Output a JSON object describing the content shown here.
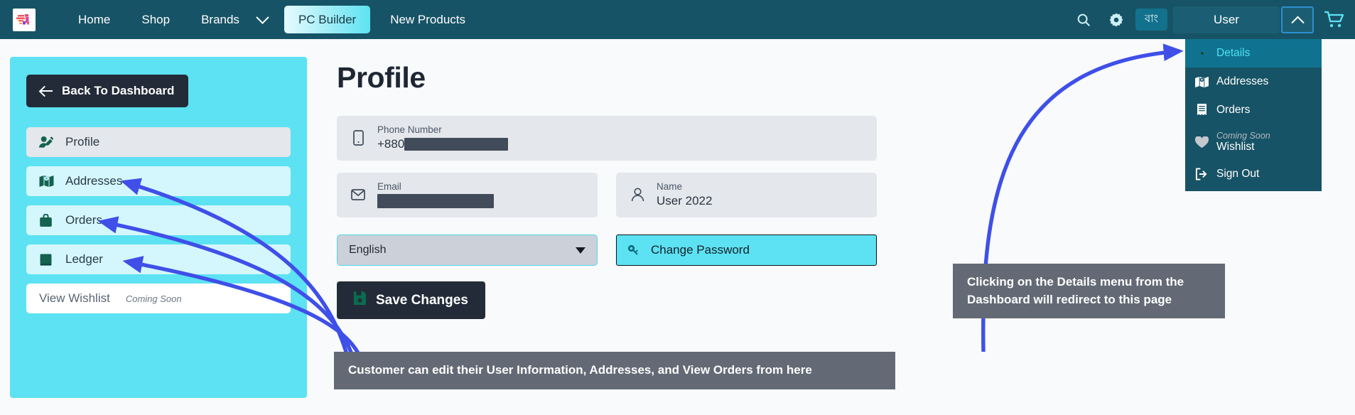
{
  "navbar": {
    "logo_name": "site-logo",
    "links": [
      {
        "label": "Home",
        "name": "nav-link-home"
      },
      {
        "label": "Shop",
        "name": "nav-link-shop"
      },
      {
        "label": "Brands",
        "name": "nav-link-brands"
      }
    ],
    "dropdown_caret": "chevron-down-icon",
    "pill": "PC Builder",
    "new_products": "New Products",
    "search_icon": "search-icon",
    "settings_icon": "gear-icon",
    "language_toggle": "বাং",
    "user_label": "User",
    "user_caret": "chevron-up-icon",
    "cart_icon": "cart-icon",
    "accent": "#175366",
    "pill_accent": "#5ee3f2"
  },
  "user_dropdown": {
    "items": [
      {
        "label": "Details",
        "icon": "dot-icon",
        "active": true,
        "badge": ""
      },
      {
        "label": "Addresses",
        "icon": "map-icon",
        "active": false,
        "badge": ""
      },
      {
        "label": "Orders",
        "icon": "receipt-icon",
        "active": false,
        "badge": ""
      },
      {
        "label": "Wishlist",
        "icon": "heart-icon",
        "active": false,
        "badge": "Coming Soon"
      },
      {
        "label": "Sign Out",
        "icon": "sign-out-icon",
        "active": false,
        "badge": ""
      }
    ],
    "active_color": "#4ee0f5",
    "bg": "#175366"
  },
  "sidebar": {
    "back_label": "Back To Dashboard",
    "items": [
      {
        "label": "Profile",
        "icon": "user-edit-icon",
        "style": "profile",
        "badge": ""
      },
      {
        "label": "Addresses",
        "icon": "map-icon",
        "style": "light",
        "badge": ""
      },
      {
        "label": "Orders",
        "icon": "bag-icon",
        "style": "light",
        "badge": ""
      },
      {
        "label": "Ledger",
        "icon": "book-icon",
        "style": "light",
        "badge": ""
      },
      {
        "label": "View Wishlist",
        "icon": "",
        "style": "white",
        "badge": "Coming Soon"
      }
    ],
    "bg": "#5ce2f2"
  },
  "main": {
    "title": "Profile",
    "phone": {
      "label": "Phone Number",
      "icon": "phone-icon",
      "prefix": "+880",
      "redacted": true
    },
    "email": {
      "label": "Email",
      "icon": "envelope-icon",
      "value": "",
      "redacted": true
    },
    "name": {
      "label": "Name",
      "icon": "person-icon",
      "value": "User 2022"
    },
    "language_select": {
      "value": "English",
      "caret": "caret-down-icon"
    },
    "change_password": {
      "label": "Change Password",
      "icon": "key-icon"
    },
    "save": {
      "label": "Save Changes",
      "icon": "save-icon"
    }
  },
  "callouts": {
    "left": "Customer can edit their User Information, Addresses, and View Orders from here",
    "right": "Clicking on the Details menu from the Dashboard will redirect to this page",
    "bg": "#636a75",
    "arrow_color": "#3f4fe8"
  }
}
